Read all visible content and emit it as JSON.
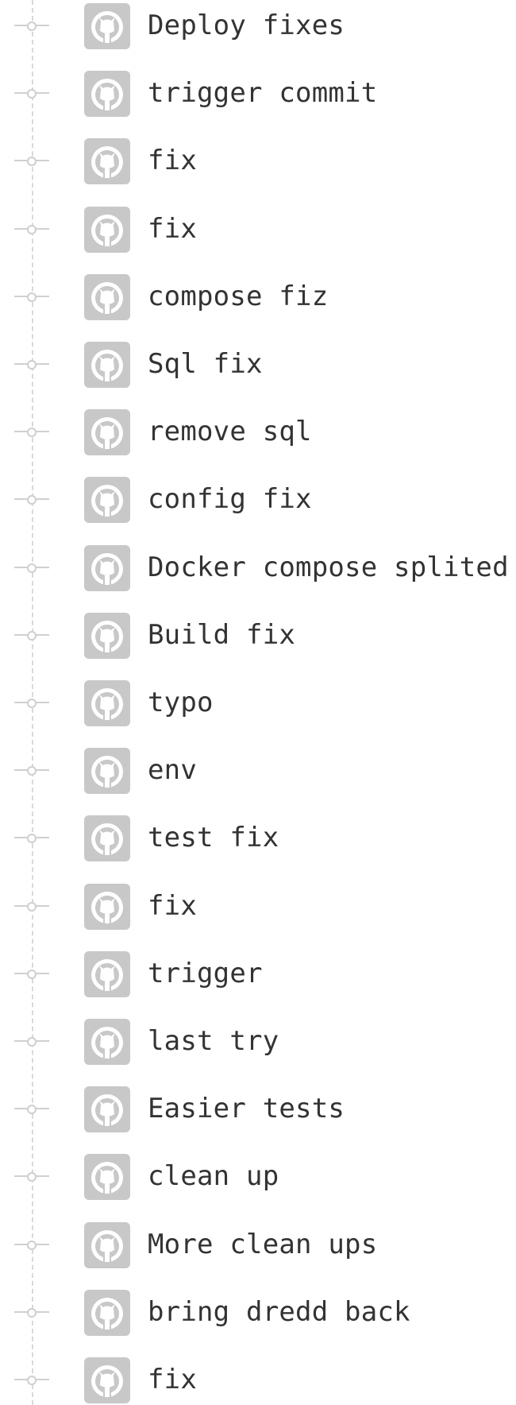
{
  "commits": [
    {
      "message": "Deploy fixes"
    },
    {
      "message": "trigger commit"
    },
    {
      "message": "fix"
    },
    {
      "message": "fix"
    },
    {
      "message": "compose fiz"
    },
    {
      "message": "Sql fix"
    },
    {
      "message": "remove sql"
    },
    {
      "message": "config fix"
    },
    {
      "message": "Docker compose splited"
    },
    {
      "message": "Build fix"
    },
    {
      "message": "typo"
    },
    {
      "message": "env"
    },
    {
      "message": "test fix"
    },
    {
      "message": "fix"
    },
    {
      "message": "trigger"
    },
    {
      "message": "last try"
    },
    {
      "message": "Easier tests"
    },
    {
      "message": "clean up"
    },
    {
      "message": "More clean ups"
    },
    {
      "message": "bring dredd back"
    },
    {
      "message": "fix"
    }
  ],
  "icons": {
    "commit_node": "commit-node-icon",
    "avatar": "github-avatar-icon"
  },
  "colors": {
    "text": "#333333",
    "avatar_bg": "#c8c8c8",
    "avatar_mark": "#ffffff",
    "timeline": "#d9d9d9"
  }
}
